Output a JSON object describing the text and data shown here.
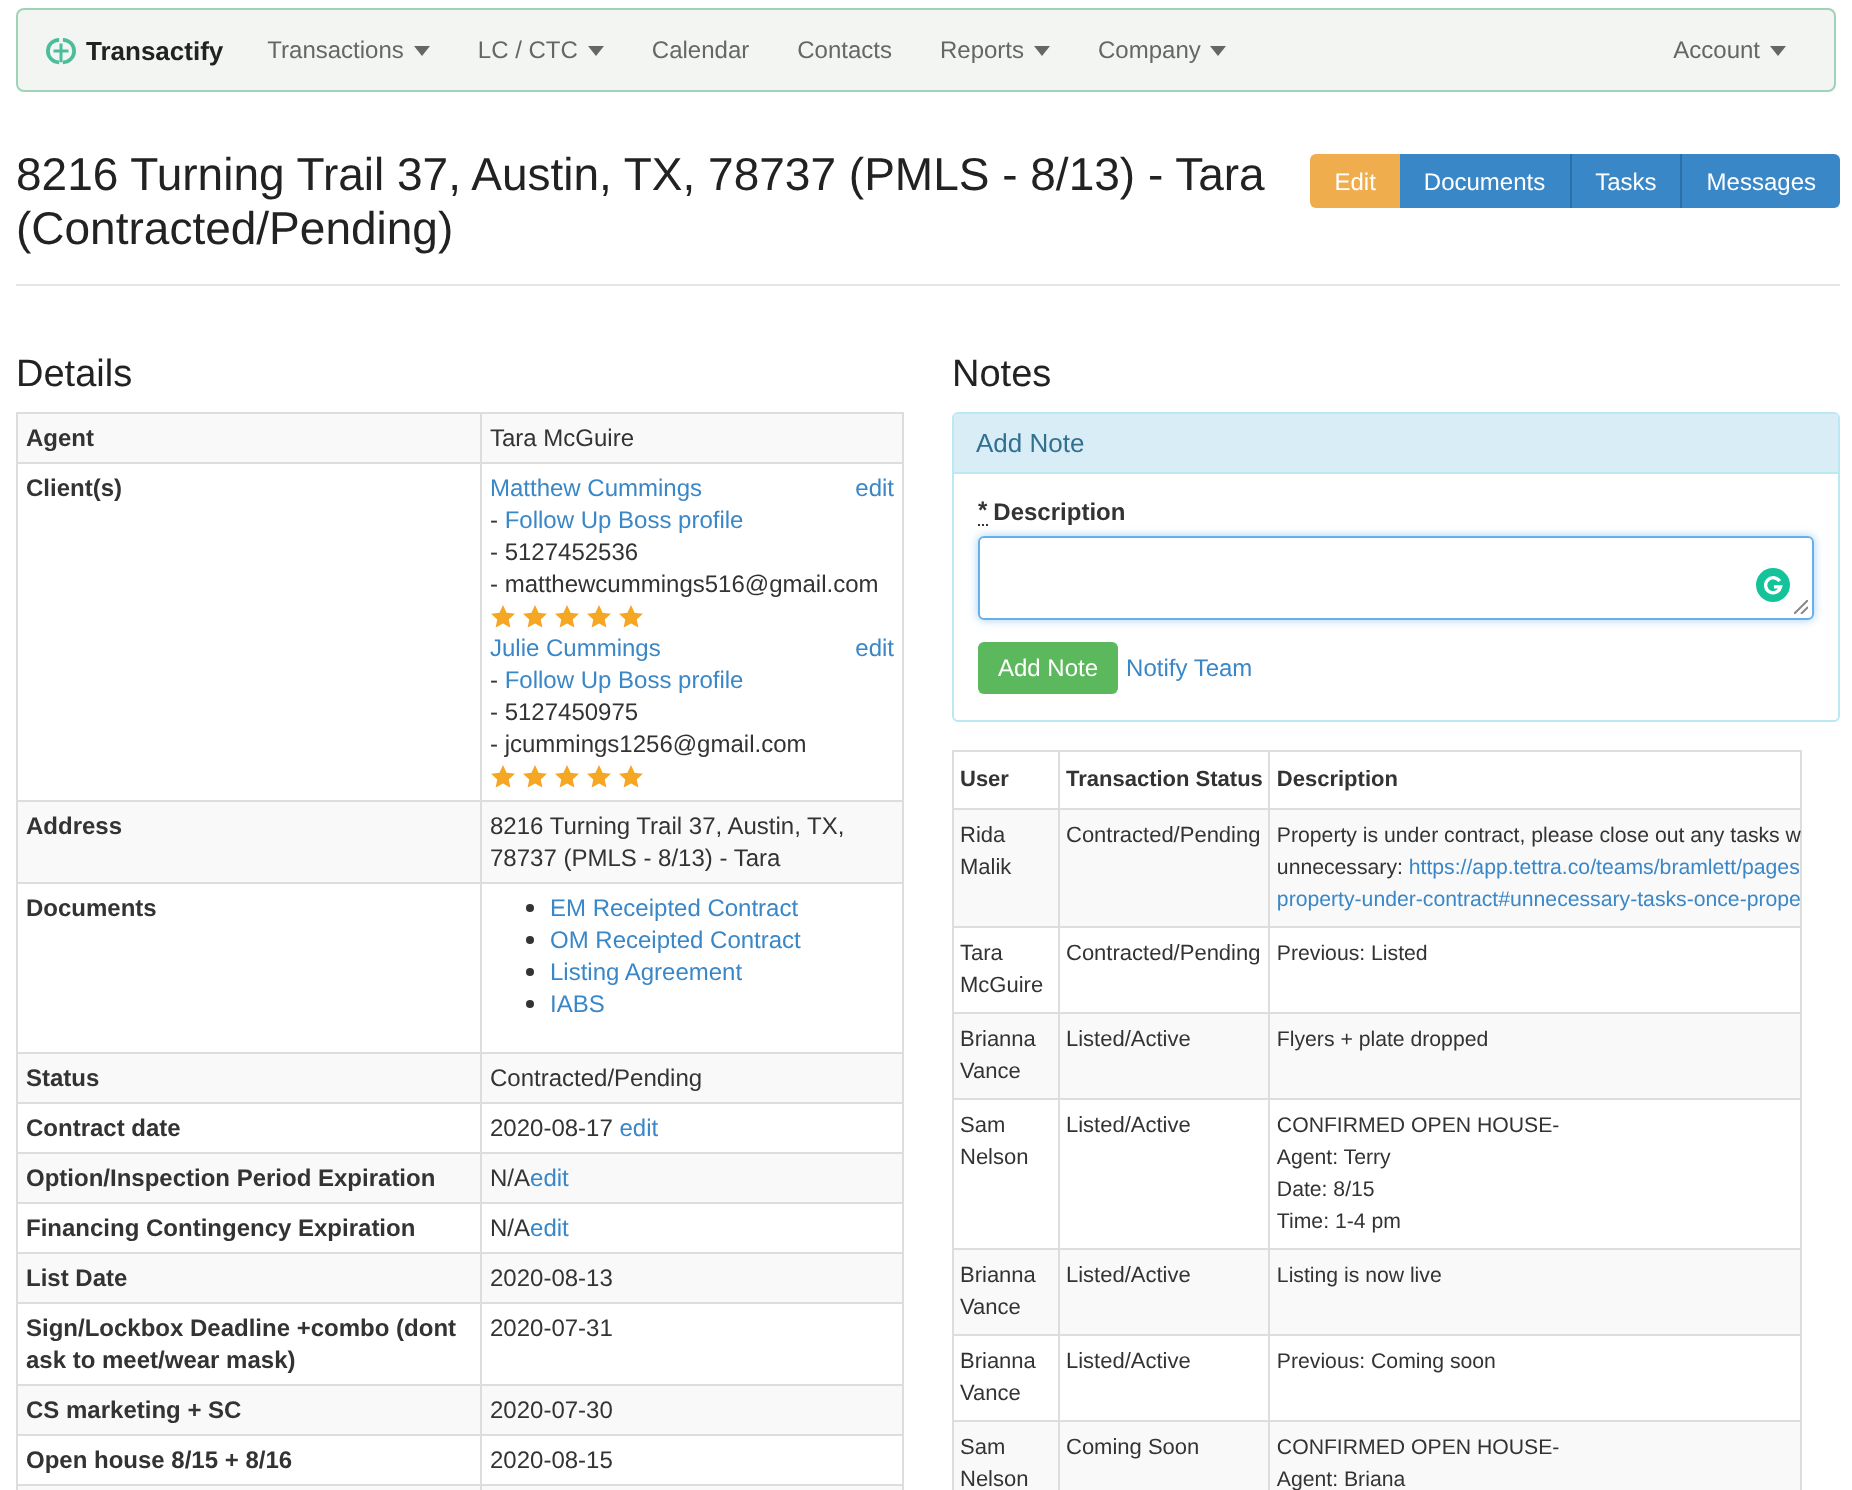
{
  "navbar": {
    "brand": "Transactify",
    "items": [
      {
        "label": "Transactions",
        "dropdown": true
      },
      {
        "label": "LC / CTC",
        "dropdown": true
      },
      {
        "label": "Calendar",
        "dropdown": false
      },
      {
        "label": "Contacts",
        "dropdown": false
      },
      {
        "label": "Reports",
        "dropdown": true
      },
      {
        "label": "Company",
        "dropdown": true
      }
    ],
    "account": {
      "label": "Account",
      "dropdown": true
    }
  },
  "title": "8216 Turning Trail 37, Austin, TX, 78737 (PMLS - 8/13) - Tara (Contracted/Pending)",
  "actions": [
    {
      "label": "Edit",
      "kind": "warning"
    },
    {
      "label": "Documents",
      "kind": "primary"
    },
    {
      "label": "Tasks",
      "kind": "primary"
    },
    {
      "label": "Messages",
      "kind": "primary"
    }
  ],
  "details": {
    "heading": "Details",
    "rows": [
      {
        "label": "Agent",
        "kind": "text",
        "value": "Tara McGuire"
      },
      {
        "label": "Client(s)",
        "kind": "clients",
        "clients": [
          {
            "name": "Matthew Cummings",
            "edit": "edit",
            "profile": "Follow Up Boss profile",
            "prefix": "- ",
            "phone": "- 5127452536",
            "email": "- matthewcummings516@gmail.com",
            "stars": 5
          },
          {
            "name": "Julie Cummings",
            "edit": "edit",
            "profile": "Follow Up Boss profile",
            "prefix": "- ",
            "phone": "- 5127450975",
            "email": "- jcummings1256@gmail.com",
            "stars": 5
          }
        ]
      },
      {
        "label": "Address",
        "kind": "text",
        "value": "8216 Turning Trail 37, Austin, TX, 78737 (PMLS - 8/13) - Tara"
      },
      {
        "label": "Documents",
        "kind": "documents",
        "documents": [
          "EM Receipted Contract",
          "OM Receipted Contract",
          "Listing Agreement",
          "IABS"
        ]
      },
      {
        "label": "Status",
        "kind": "text",
        "value": "Contracted/Pending"
      },
      {
        "label": "Contract date",
        "kind": "text",
        "value": "2020-08-17 ",
        "edit": "edit"
      },
      {
        "label": "Option/Inspection Period Expiration",
        "kind": "text",
        "value": "N/A",
        "edit": "edit"
      },
      {
        "label": "Financing Contingency Expiration",
        "kind": "text",
        "value": "N/A",
        "edit": "edit"
      },
      {
        "label": "List Date",
        "kind": "text",
        "value": "2020-08-13"
      },
      {
        "label": "Sign/Lockbox Deadline +combo (dont ask to meet/wear mask)",
        "kind": "text",
        "value": "2020-07-31"
      },
      {
        "label": "CS marketing + SC",
        "kind": "text",
        "value": "2020-07-30"
      },
      {
        "label": "Open house 8/15 + 8/16",
        "kind": "text",
        "value": "2020-08-15"
      }
    ]
  },
  "notes": {
    "heading": "Notes",
    "form": {
      "title": "Add Note",
      "required_mark": "*",
      "label": "Description",
      "submit": "Add Note",
      "notify": "Notify Team"
    },
    "columns": [
      "User",
      "Transaction Status",
      "Description"
    ],
    "rows": [
      {
        "user": "Rida Malik",
        "status": "Contracted/Pending",
        "lines": [
          [
            {
              "text": "Property is under contract, please close out any tasks w",
              "link": false
            }
          ],
          [
            {
              "text": "unnecessary: ",
              "link": false
            },
            {
              "text": "https://app.tettra.co/teams/bramlett/pages",
              "link": true
            }
          ],
          [
            {
              "text": "property-under-contract#unnecessary-tasks-once-prope",
              "link": true
            }
          ]
        ]
      },
      {
        "user": "Tara McGuire",
        "status": "Contracted/Pending",
        "lines": [
          [
            {
              "text": "Previous: Listed",
              "link": false
            }
          ]
        ]
      },
      {
        "user": "Brianna Vance",
        "status": "Listed/Active",
        "lines": [
          [
            {
              "text": "Flyers + plate dropped",
              "link": false
            }
          ]
        ]
      },
      {
        "user": "Sam Nelson",
        "status": "Listed/Active",
        "lines": [
          [
            {
              "text": "CONFIRMED OPEN HOUSE-",
              "link": false
            }
          ],
          [
            {
              "text": "Agent: Terry",
              "link": false
            }
          ],
          [
            {
              "text": "Date: 8/15",
              "link": false
            }
          ],
          [
            {
              "text": "Time: 1-4 pm",
              "link": false
            }
          ]
        ]
      },
      {
        "user": "Brianna Vance",
        "status": "Listed/Active",
        "lines": [
          [
            {
              "text": "Listing is now live",
              "link": false
            }
          ]
        ]
      },
      {
        "user": "Brianna Vance",
        "status": "Listed/Active",
        "lines": [
          [
            {
              "text": "Previous: Coming soon",
              "link": false
            }
          ]
        ]
      },
      {
        "user": "Sam Nelson",
        "status": "Coming Soon",
        "lines": [
          [
            {
              "text": "CONFIRMED OPEN HOUSE-",
              "link": false
            }
          ],
          [
            {
              "text": "Agent: Briana",
              "link": false
            }
          ]
        ]
      }
    ]
  }
}
